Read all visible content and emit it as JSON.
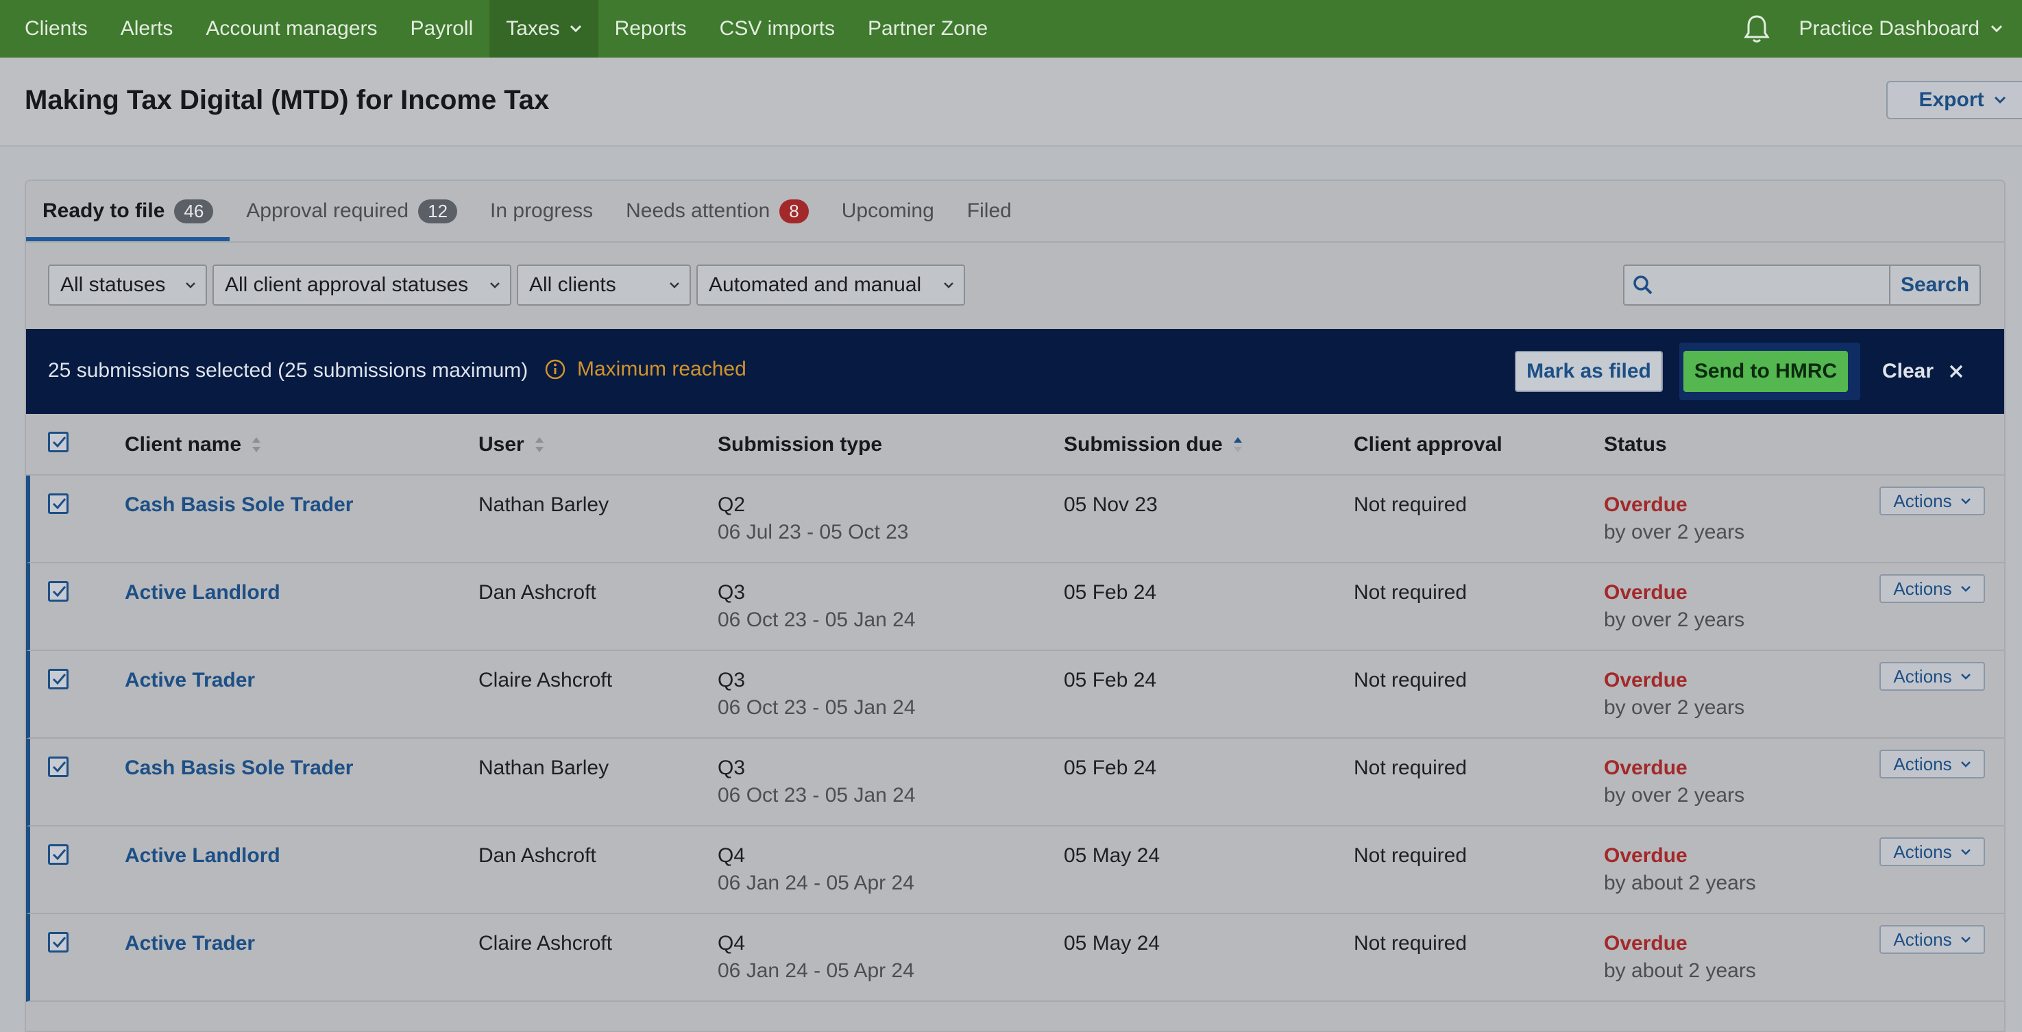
{
  "nav": {
    "items": [
      "Clients",
      "Alerts",
      "Account managers",
      "Payroll",
      "Taxes",
      "Reports",
      "CSV imports",
      "Partner Zone"
    ],
    "active": "Taxes",
    "practice": "Practice Dashboard"
  },
  "header": {
    "title": "Making Tax Digital (MTD) for Income Tax",
    "export": "Export"
  },
  "tabs": [
    {
      "label": "Ready to file",
      "badge": "46"
    },
    {
      "label": "Approval required",
      "badge": "12"
    },
    {
      "label": "In progress",
      "badge": ""
    },
    {
      "label": "Needs attention",
      "badge": "8"
    },
    {
      "label": "Upcoming",
      "badge": ""
    },
    {
      "label": "Filed",
      "badge": ""
    }
  ],
  "filters": {
    "status": "All statuses",
    "approval": "All client approval statuses",
    "clients": "All clients",
    "mode": "Automated and manual",
    "search_placeholder": "",
    "search_button": "Search"
  },
  "selection": {
    "count_text": "25 submissions selected (25 submissions maximum)",
    "max_text": "Maximum reached",
    "mark_filed": "Mark as filed",
    "send": "Send to HMRC",
    "clear": "Clear"
  },
  "table": {
    "headers": {
      "client": "Client name",
      "user": "User",
      "type": "Submission type",
      "due": "Submission due",
      "approval": "Client approval",
      "status": "Status"
    },
    "actions_label": "Actions",
    "rows": [
      {
        "client": "Cash Basis Sole Trader",
        "user": "Nathan Barley",
        "quarter": "Q2",
        "period": "06 Jul 23 - 05 Oct 23",
        "due": "05 Nov 23",
        "approval": "Not required",
        "status": "Overdue",
        "status_detail": "by over 2 years"
      },
      {
        "client": "Active Landlord",
        "user": "Dan Ashcroft",
        "quarter": "Q3",
        "period": "06 Oct 23 - 05 Jan 24",
        "due": "05 Feb 24",
        "approval": "Not required",
        "status": "Overdue",
        "status_detail": "by over 2 years"
      },
      {
        "client": "Active Trader",
        "user": "Claire Ashcroft",
        "quarter": "Q3",
        "period": "06 Oct 23 - 05 Jan 24",
        "due": "05 Feb 24",
        "approval": "Not required",
        "status": "Overdue",
        "status_detail": "by over 2 years"
      },
      {
        "client": "Cash Basis Sole Trader",
        "user": "Nathan Barley",
        "quarter": "Q3",
        "period": "06 Oct 23 - 05 Jan 24",
        "due": "05 Feb 24",
        "approval": "Not required",
        "status": "Overdue",
        "status_detail": "by over 2 years"
      },
      {
        "client": "Active Landlord",
        "user": "Dan Ashcroft",
        "quarter": "Q4",
        "period": "06 Jan 24 - 05 Apr 24",
        "due": "05 May 24",
        "approval": "Not required",
        "status": "Overdue",
        "status_detail": "by about 2 years"
      },
      {
        "client": "Active Trader",
        "user": "Claire Ashcroft",
        "quarter": "Q4",
        "period": "06 Jan 24 - 05 Apr 24",
        "due": "05 May 24",
        "approval": "Not required",
        "status": "Overdue",
        "status_detail": "by about 2 years"
      }
    ]
  }
}
